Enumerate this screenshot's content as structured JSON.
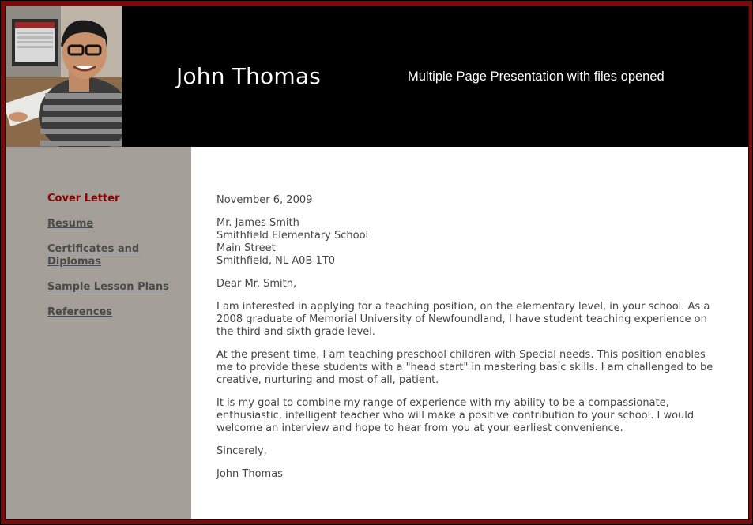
{
  "header": {
    "name": "John Thomas",
    "subtitle": "Multiple Page Presentation with files opened"
  },
  "sidebar": {
    "items": [
      {
        "label": "Cover Letter",
        "active": true
      },
      {
        "label": "Resume"
      },
      {
        "label": "Certificates and Diplomas"
      },
      {
        "label": "Sample Lesson Plans"
      },
      {
        "label": "References"
      }
    ]
  },
  "letter": {
    "date": "November 6, 2009",
    "address": [
      "Mr. James Smith",
      "Smithfield Elementary School",
      "Main Street",
      "Smithfield, NL A0B 1T0"
    ],
    "salutation": "Dear Mr. Smith,",
    "paragraphs": [
      "I am interested in applying for a teaching position, on the elementary level, in your school. As a 2008 graduate of Memorial University of Newfoundland, I have student teaching experience on the third and sixth grade level.",
      "At the present time, I am teaching preschool children with Special needs. This position enables me to provide these students with a \"head start\" in mastering basic skills. I am challenged to be creative, nurturing and most of all, patient.",
      "It is my goal to combine my range of experience with my ability to be a compassionate, enthusiastic, intelligent teacher who will make a positive contribution to your school. I would welcome an interview and hope to hear from you at your earliest convenience."
    ],
    "closing": "Sincerely,",
    "signature": "John Thomas"
  },
  "colors": {
    "frame": "#7a0b0b",
    "sidebar": "#a49f98",
    "active_nav": "#8b0000"
  }
}
